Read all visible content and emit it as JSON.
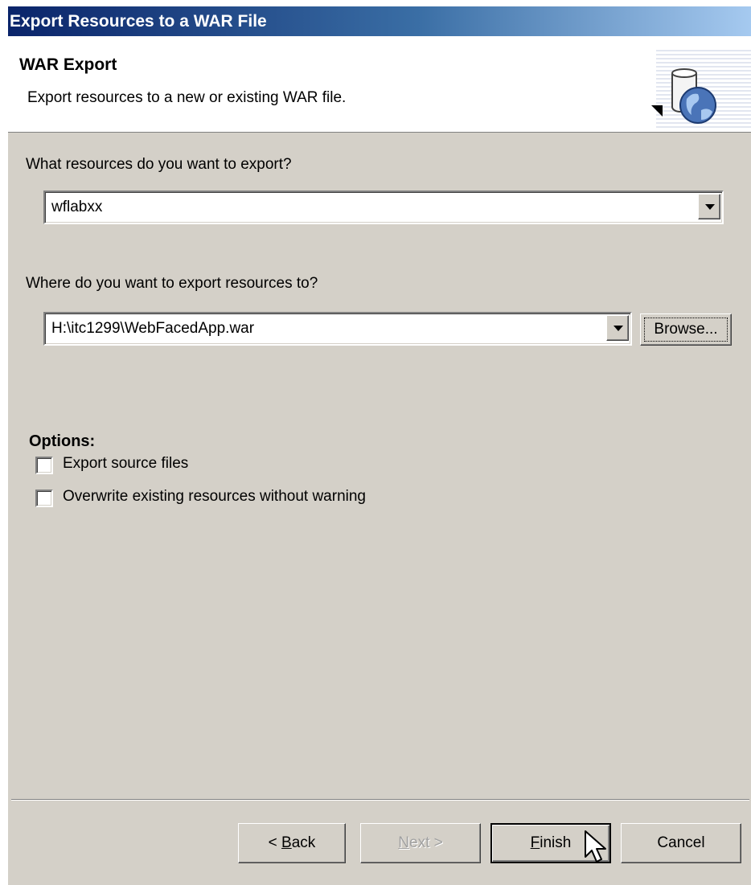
{
  "window": {
    "title": "Export Resources to a WAR File"
  },
  "header": {
    "title": "WAR Export",
    "description": "Export resources to a new or existing WAR file.",
    "icon": "war-globe-icon"
  },
  "resources": {
    "label": "What resources do you want to export?",
    "value": "wflabxx"
  },
  "destination": {
    "label": "Where do you want to export resources to?",
    "value": "H:\\itc1299\\WebFacedApp.war",
    "browse_label": "Browse..."
  },
  "options": {
    "title": "Options:",
    "items": [
      {
        "label": "Export source files",
        "checked": false
      },
      {
        "label": "Overwrite existing resources without warning",
        "checked": false
      }
    ]
  },
  "buttons": {
    "back": {
      "mnemonic": "B",
      "before": "< ",
      "after": "ack"
    },
    "next": {
      "mnemonic": "N",
      "before": "",
      "after": "ext >"
    },
    "finish": {
      "mnemonic": "F",
      "before": "",
      "after": "inish"
    },
    "cancel": "Cancel"
  }
}
